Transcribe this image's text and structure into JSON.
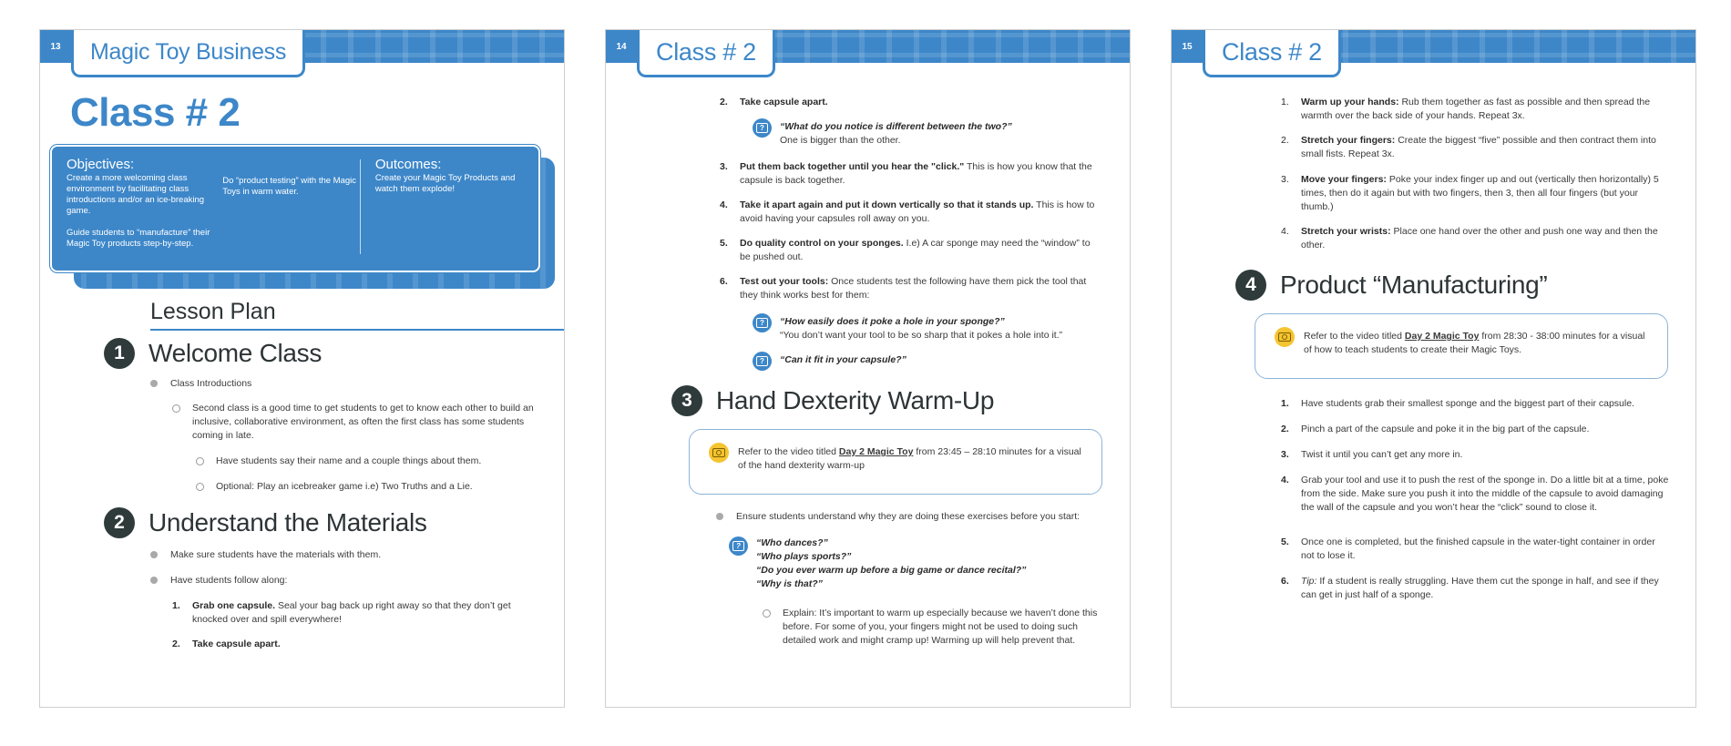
{
  "pages": [
    {
      "page_number": "13",
      "tab_title": "Magic Toy Business",
      "big_title": "Class # 2",
      "objectives": {
        "heading": "Objectives:",
        "items": [
          "Create a more welcoming class environment by facilitating class introductions and/or an ice-breaking game.",
          "Guide students to “manufacture” their Magic Toy products step-by-step.",
          "Do “product testing” with the Magic Toys in warm water."
        ]
      },
      "outcomes": {
        "heading": "Outcomes:",
        "items": [
          "Create your Magic Toy Products and watch them explode!"
        ]
      },
      "lesson_plan": "Lesson Plan",
      "sections": [
        {
          "number": "1",
          "title": "Welcome Class",
          "bullet": "Class Introductions",
          "sub": "Second class is a good time to get students to get to know each other to build an inclusive, collaborative environment, as often the first class has some students coming in late.",
          "subsub": [
            "Have students say their name and a couple things about them.",
            "Optional: Play an icebreaker game i.e) Two Truths and a Lie."
          ]
        },
        {
          "number": "2",
          "title": "Understand the Materials",
          "bullets": [
            "Make sure students have the materials with them.",
            "Have students follow along:"
          ],
          "steps": [
            {
              "n": "1.",
              "bold": "Grab one capsule.",
              "text": " Seal your bag back up right away so that they don’t get knocked over and spill everywhere!"
            },
            {
              "n": "2.",
              "bold": "Take capsule apart.",
              "text": ""
            }
          ]
        }
      ]
    },
    {
      "page_number": "14",
      "tab_title": "Class # 2",
      "steps": [
        {
          "n": "2.",
          "bold": "Take capsule apart.",
          "text": ""
        },
        {
          "n": "3.",
          "bold": "Put them back together until you hear the \"click.\"",
          "text": " This is how you know that the capsule is back together."
        },
        {
          "n": "4.",
          "bold": "Take it apart again and put it down vertically so that it stands up.",
          "text": " This is how to avoid having your capsules roll away on you."
        },
        {
          "n": "5.",
          "bold": "Do quality control on your sponges.",
          "text": " I.e) A car sponge may need the “window” to be pushed out."
        },
        {
          "n": "6.",
          "bold": "Test out your tools:",
          "text": "  Once students test the following have them pick the tool that they think works best for them:"
        }
      ],
      "questions": [
        {
          "q": "“What do you notice is different between the two?”",
          "a": "One is bigger than the other."
        },
        {
          "q": "“How easily does it poke a hole in your sponge?”",
          "a": "“You don’t want your tool to be so sharp that it pokes a hole into it.”"
        },
        {
          "q": "“Can it fit in your capsule?”",
          "a": ""
        }
      ],
      "section3": {
        "number": "3",
        "title": "Hand Dexterity Warm-Up",
        "video": {
          "prefix": "Refer to the video titled ",
          "link": "Day 2 Magic Toy",
          "suffix": " from 23:45 – 28:10 minutes for a visual of the hand dexterity warm-up"
        },
        "bullet": "Ensure students understand why they are doing these exercises before you start:",
        "question_lines": [
          "“Who dances?”",
          "“Who plays sports?”",
          "“Do you ever warm up before a big game or dance recital?”",
          "“Why is that?”"
        ],
        "explain": "Explain: It’s important to warm up especially because we haven’t done this before. For some of you, your fingers might not be used to doing such detailed work and might cramp up! Warming up will help prevent that."
      }
    },
    {
      "page_number": "15",
      "tab_title": "Class # 2",
      "warmups": [
        {
          "n": "1.",
          "bold": "Warm up your hands:",
          "text": " Rub them together as fast as possible and then spread the warmth over the back side of your hands. Repeat 3x."
        },
        {
          "n": "2.",
          "bold": "Stretch your fingers:",
          "text": " Create the biggest “five” possible and then contract them into small fists. Repeat 3x."
        },
        {
          "n": "3.",
          "bold": "Move your fingers:",
          "text": " Poke your index finger up and out (vertically then horizontally) 5 times, then do it again but with two fingers, then 3, then all four fingers (but your thumb.)"
        },
        {
          "n": "4.",
          "bold": "Stretch your wrists:",
          "text": " Place one hand over the other and push one way and then the other."
        }
      ],
      "section4": {
        "number": "4",
        "title": "Product “Manufacturing”",
        "video": {
          "prefix": "Refer to the video titled ",
          "link": "Day 2 Magic Toy",
          "suffix": " from 28:30 - 38:00 minutes for a visual of how to teach students to create their Magic Toys."
        },
        "steps": [
          {
            "n": "1.",
            "text": "Have students grab their smallest sponge and the biggest part of their capsule."
          },
          {
            "n": "2.",
            "text": "Pinch a part of the capsule and poke it in the big part of the capsule."
          },
          {
            "n": "3.",
            "text": "Twist it until you can’t get any more in."
          },
          {
            "n": "4.",
            "text": "Grab your tool and use it to push the rest of the sponge in. Do a little bit at a time, poke from the side. Make sure you push it into the middle of the capsule to avoid damaging the wall of the capsule and you won’t hear the “click” sound to close it."
          },
          {
            "n": "5.",
            "text": "Once one is completed, but the finished capsule in the water-tight container in order not to lose it."
          },
          {
            "n": "6.",
            "tip_label": "Tip:",
            "text": " If a student is really struggling. Have them cut the sponge in half, and see if they can get in just half of a sponge."
          }
        ]
      }
    }
  ]
}
